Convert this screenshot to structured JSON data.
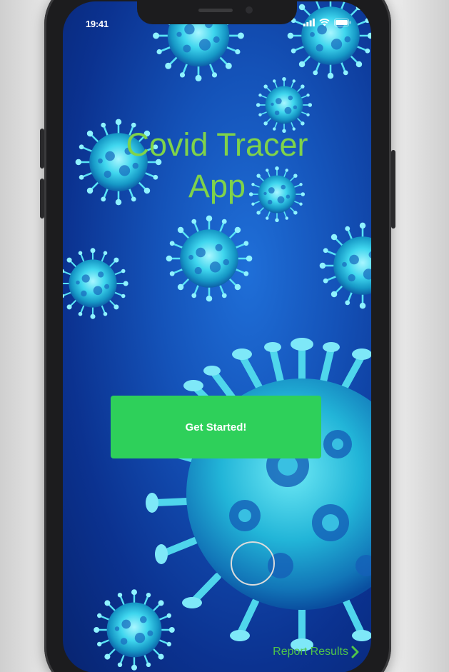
{
  "status_bar": {
    "time": "19:41",
    "icons": [
      "signal-icon",
      "wifi-icon",
      "battery-icon"
    ]
  },
  "app": {
    "title_line1": "Covid Tracer",
    "title_line2": "App",
    "get_started_label": "Get Started!",
    "report_results_label": "Report Results"
  },
  "colors": {
    "title": "#7fd34a",
    "button": "#2ed05a",
    "report_link": "#4fc54a",
    "background": "#1452b8"
  }
}
